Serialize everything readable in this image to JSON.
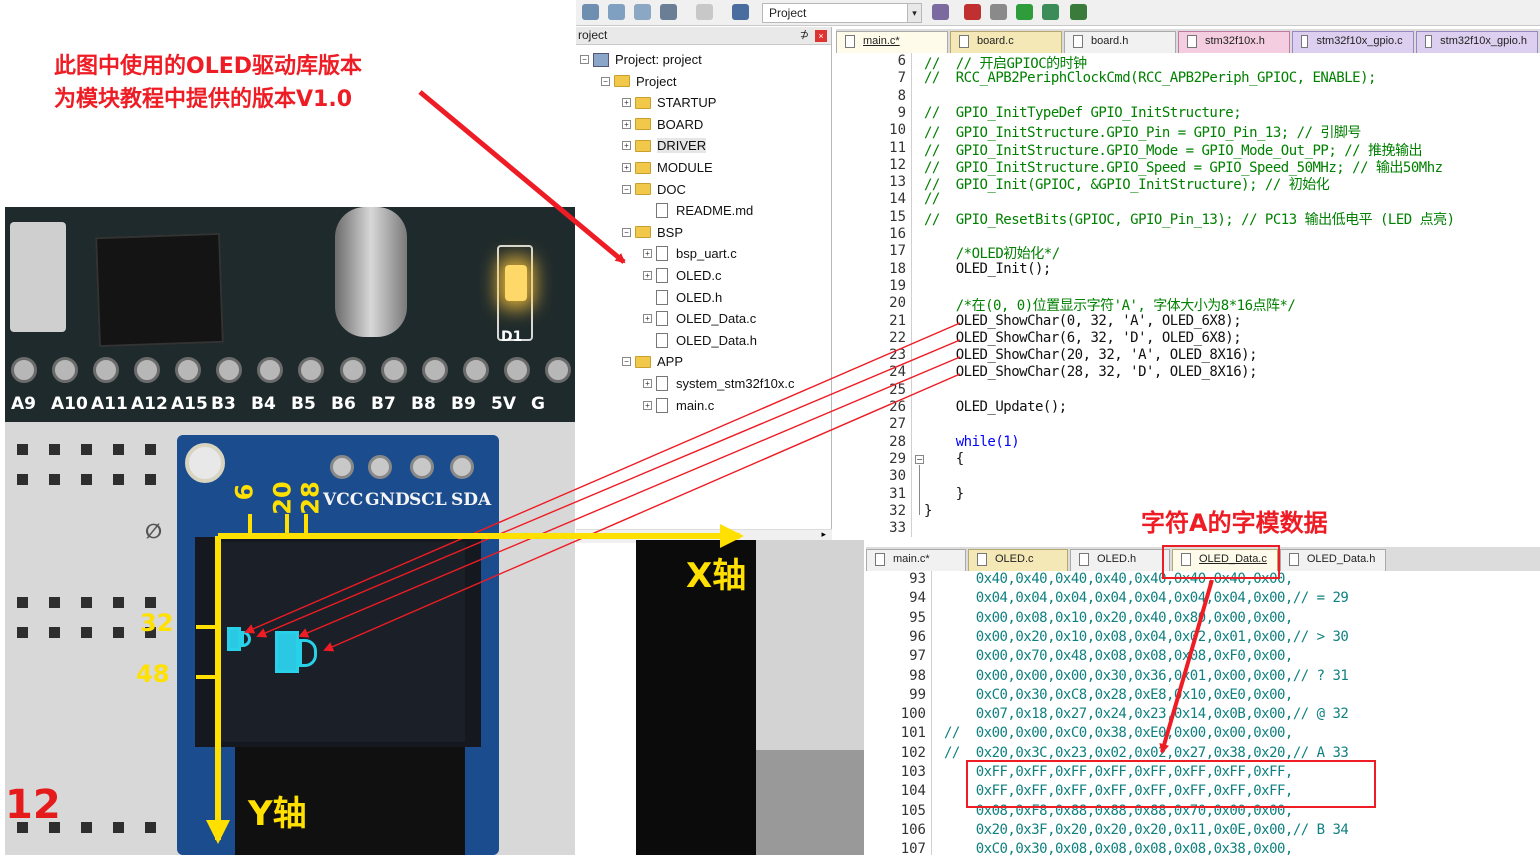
{
  "annotation": {
    "line1": "此图中使用的OLED驱动库版本",
    "line2": "为模块教程中提供的版本V1.0"
  },
  "toolbar": {
    "target_name": "Project",
    "target_arrow": "▾"
  },
  "project_panel": {
    "title": "roject",
    "pin": "⊅",
    "close": "×",
    "tree": [
      {
        "label": "Project: project",
        "indent": 0,
        "kind": "proj",
        "exp": "−"
      },
      {
        "label": "Project",
        "indent": 1,
        "kind": "folder",
        "exp": "−"
      },
      {
        "label": "STARTUP",
        "indent": 2,
        "kind": "folder",
        "exp": "+"
      },
      {
        "label": "BOARD",
        "indent": 2,
        "kind": "folder",
        "exp": "+"
      },
      {
        "label": "DRIVER",
        "indent": 2,
        "kind": "folder",
        "exp": "+",
        "selected": true
      },
      {
        "label": "MODULE",
        "indent": 2,
        "kind": "folder",
        "exp": "+"
      },
      {
        "label": "DOC",
        "indent": 2,
        "kind": "folder",
        "exp": "−"
      },
      {
        "label": "README.md",
        "indent": 3,
        "kind": "file",
        "exp": ""
      },
      {
        "label": "BSP",
        "indent": 2,
        "kind": "folder",
        "exp": "−"
      },
      {
        "label": "bsp_uart.c",
        "indent": 3,
        "kind": "file",
        "exp": "+"
      },
      {
        "label": "OLED.c",
        "indent": 3,
        "kind": "file",
        "exp": "+"
      },
      {
        "label": "OLED.h",
        "indent": 3,
        "kind": "file",
        "exp": ""
      },
      {
        "label": "OLED_Data.c",
        "indent": 3,
        "kind": "file",
        "exp": "+"
      },
      {
        "label": "OLED_Data.h",
        "indent": 3,
        "kind": "file",
        "exp": ""
      },
      {
        "label": "APP",
        "indent": 2,
        "kind": "folder",
        "exp": "−"
      },
      {
        "label": "system_stm32f10x.c",
        "indent": 3,
        "kind": "file",
        "exp": "+"
      },
      {
        "label": "main.c",
        "indent": 3,
        "kind": "file",
        "exp": "+"
      }
    ]
  },
  "top_editor": {
    "tabs": [
      {
        "label": "main.c*",
        "style": "h active"
      },
      {
        "label": "board.c",
        "style": ""
      },
      {
        "label": "board.h",
        "style": "h"
      },
      {
        "label": "stm32f10x.h",
        "style": "pink"
      },
      {
        "label": "stm32f10x_gpio.c",
        "style": "lav"
      },
      {
        "label": "stm32f10x_gpio.h",
        "style": "lav"
      }
    ],
    "lines": [
      {
        "n": "6",
        "text": "//  // 开启GPIOC的时钟",
        "c": ""
      },
      {
        "n": "7",
        "text": "//  RCC_APB2PeriphClockCmd(RCC_APB2Periph_GPIOC, ENABLE);",
        "c": ""
      },
      {
        "n": "8",
        "text": "",
        "c": ""
      },
      {
        "n": "9",
        "text": "//  GPIO_InitTypeDef GPIO_InitStructure;",
        "c": ""
      },
      {
        "n": "10",
        "text": "//  GPIO_InitStructure.GPIO_Pin = GPIO_Pin_13; // 引脚号",
        "c": ""
      },
      {
        "n": "11",
        "text": "//  GPIO_InitStructure.GPIO_Mode = GPIO_Mode_Out_PP; // 推挽输出",
        "c": ""
      },
      {
        "n": "12",
        "text": "//  GPIO_InitStructure.GPIO_Speed = GPIO_Speed_50MHz; // 输出50Mhz",
        "c": ""
      },
      {
        "n": "13",
        "text": "//  GPIO_Init(GPIOC, &GPIO_InitStructure); // 初始化",
        "c": ""
      },
      {
        "n": "14",
        "text": "//",
        "c": ""
      },
      {
        "n": "15",
        "text": "//  GPIO_ResetBits(GPIOC, GPIO_Pin_13); // PC13 输出低电平 (LED 点亮)",
        "c": ""
      },
      {
        "n": "16",
        "text": "",
        "c": ""
      },
      {
        "n": "17",
        "text": "    /*OLED初始化*/",
        "c": ""
      },
      {
        "n": "18",
        "text": "    OLED_Init();",
        "c": "black"
      },
      {
        "n": "19",
        "text": "",
        "c": ""
      },
      {
        "n": "20",
        "text": "    /*在(0, 0)位置显示字符'A', 字体大小为8*16点阵*/",
        "c": ""
      },
      {
        "n": "21",
        "text": "    OLED_ShowChar(0, 32, 'A', OLED_6X8);",
        "c": "black"
      },
      {
        "n": "22",
        "text": "    OLED_ShowChar(6, 32, 'D', OLED_6X8);",
        "c": "black"
      },
      {
        "n": "23",
        "text": "    OLED_ShowChar(20, 32, 'A', OLED_8X16);",
        "c": "black"
      },
      {
        "n": "24",
        "text": "    OLED_ShowChar(28, 32, 'D', OLED_8X16);",
        "c": "black"
      },
      {
        "n": "25",
        "text": "",
        "c": ""
      },
      {
        "n": "26",
        "text": "    OLED_Update();",
        "c": "black"
      },
      {
        "n": "27",
        "text": "",
        "c": ""
      },
      {
        "n": "28",
        "text": "    while(1)",
        "c": "blue"
      },
      {
        "n": "29",
        "text": "    {",
        "c": "black"
      },
      {
        "n": "30",
        "text": "",
        "c": ""
      },
      {
        "n": "31",
        "text": "    }",
        "c": "black"
      },
      {
        "n": "32",
        "text": "}",
        "c": "black"
      },
      {
        "n": "33",
        "text": "",
        "c": ""
      }
    ]
  },
  "bottom_editor": {
    "tabs": [
      {
        "label": "main.c*",
        "style": "h"
      },
      {
        "label": "OLED.c",
        "style": ""
      },
      {
        "label": "OLED.h",
        "style": "h"
      },
      {
        "label": "OLED_Data.c",
        "style": "active"
      },
      {
        "label": "OLED_Data.h",
        "style": "h"
      }
    ],
    "lines": [
      {
        "n": "93",
        "text": "    0x40,0x40,0x40,0x40,0x40,0x40,0x40,0x00,",
        "c": "teal"
      },
      {
        "n": "94",
        "text": "    0x04,0x04,0x04,0x04,0x04,0x04,0x04,0x00,// = 29",
        "c": "teal"
      },
      {
        "n": "95",
        "text": "    0x00,0x08,0x10,0x20,0x40,0x80,0x00,0x00,",
        "c": "teal"
      },
      {
        "n": "96",
        "text": "    0x00,0x20,0x10,0x08,0x04,0x02,0x01,0x00,// > 30",
        "c": "teal"
      },
      {
        "n": "97",
        "text": "    0x00,0x70,0x48,0x08,0x08,0x08,0xF0,0x00,",
        "c": "teal"
      },
      {
        "n": "98",
        "text": "    0x00,0x00,0x00,0x30,0x36,0x01,0x00,0x00,// ? 31",
        "c": "teal"
      },
      {
        "n": "99",
        "text": "    0xC0,0x30,0xC8,0x28,0xE8,0x10,0xE0,0x00,",
        "c": "teal"
      },
      {
        "n": "100",
        "text": "    0x07,0x18,0x27,0x24,0x23,0x14,0x0B,0x00,// @ 32",
        "c": "teal"
      },
      {
        "n": "101",
        "text": "//  0x00,0x00,0xC0,0x38,0xE0,0x00,0x00,0x00,",
        "c": "teal"
      },
      {
        "n": "102",
        "text": "//  0x20,0x3C,0x23,0x02,0x02,0x27,0x38,0x20,// A 33",
        "c": "teal"
      },
      {
        "n": "103",
        "text": "    0xFF,0xFF,0xFF,0xFF,0xFF,0xFF,0xFF,0xFF,",
        "c": "teal"
      },
      {
        "n": "104",
        "text": "    0xFF,0xFF,0xFF,0xFF,0xFF,0xFF,0xFF,0xFF,",
        "c": "teal"
      },
      {
        "n": "105",
        "text": "    0x08,0xF8,0x88,0x88,0x88,0x70,0x00,0x00,",
        "c": "teal"
      },
      {
        "n": "106",
        "text": "    0x20,0x3F,0x20,0x20,0x20,0x11,0x0E,0x00,// B 34",
        "c": "teal"
      },
      {
        "n": "107",
        "text": "    0xC0,0x30,0x08,0x08,0x08,0x08,0x38,0x00,",
        "c": "teal"
      }
    ]
  },
  "photo": {
    "pin_labels": [
      "A9",
      "A10",
      "A11",
      "A12",
      "A15",
      "B3",
      "B4",
      "B5",
      "B6",
      "B7",
      "B8",
      "B9",
      "5V",
      "G"
    ],
    "oled_pins": [
      "VCC",
      "GND",
      "SCL",
      "SDA"
    ],
    "board_mark": "D1",
    "edge_num": "12",
    "logo": "∅"
  },
  "axes": {
    "x_label": "X轴",
    "y_label": "Y轴",
    "x_ticks": [
      "6",
      "20",
      "28"
    ],
    "y_ticks": [
      "32",
      "48"
    ]
  },
  "font_data_title": "字符A的字模数据",
  "colors": {
    "annotation_red": "#ee1c24",
    "axis_yellow": "#ffe000",
    "oled_cyan": "#2ac8e2"
  }
}
